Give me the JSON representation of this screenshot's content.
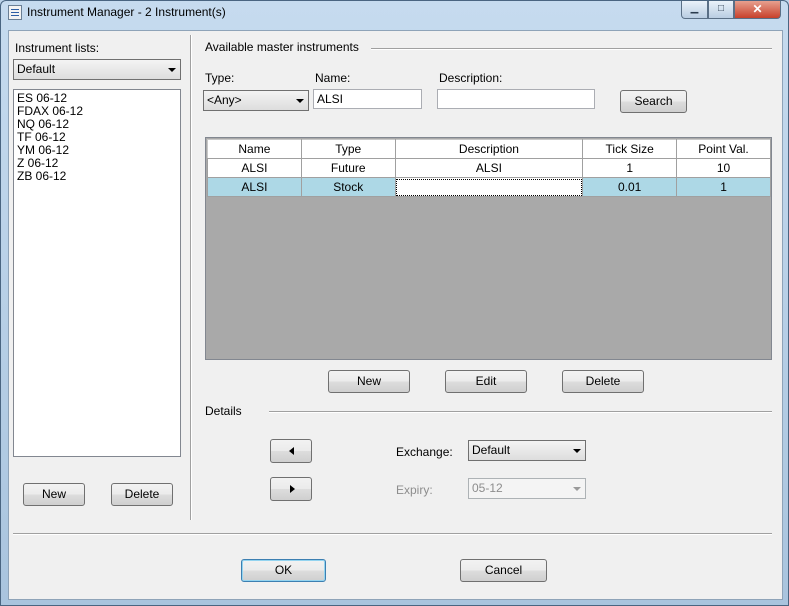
{
  "window": {
    "title": "Instrument Manager - 2 Instrument(s)",
    "controls": {
      "minimize": "▁",
      "maximize": "□",
      "close": "✕"
    }
  },
  "left_panel": {
    "lists_label": "Instrument lists:",
    "lists_selected": "Default",
    "instruments": [
      "ES 06-12",
      "FDAX 06-12",
      "NQ 06-12",
      "TF 06-12",
      "YM 06-12",
      "Z 06-12",
      "ZB 06-12"
    ],
    "new_label": "New",
    "delete_label": "Delete"
  },
  "master": {
    "section_label": "Available master instruments",
    "type_label": "Type:",
    "type_value": "<Any>",
    "name_label": "Name:",
    "name_value": "ALSI",
    "description_label": "Description:",
    "description_value": "",
    "search_label": "Search",
    "columns": [
      "Name",
      "Type",
      "Description",
      "Tick Size",
      "Point Val."
    ],
    "rows": [
      [
        "ALSI",
        "Future",
        "ALSI",
        "1",
        "10"
      ],
      [
        "ALSI",
        "Stock",
        "",
        "0.01",
        "1"
      ]
    ],
    "selected_row": 1,
    "new_label": "New",
    "edit_label": "Edit",
    "delete_label": "Delete"
  },
  "details": {
    "section_label": "Details",
    "exchange_label": "Exchange:",
    "exchange_value": "Default",
    "expiry_label": "Expiry:",
    "expiry_value": "05-12"
  },
  "footer": {
    "ok_label": "OK",
    "cancel_label": "Cancel"
  },
  "icons": {
    "app": "instrument-manager-icon",
    "move_left": "triangle-left-icon",
    "move_right": "triangle-right-icon"
  }
}
